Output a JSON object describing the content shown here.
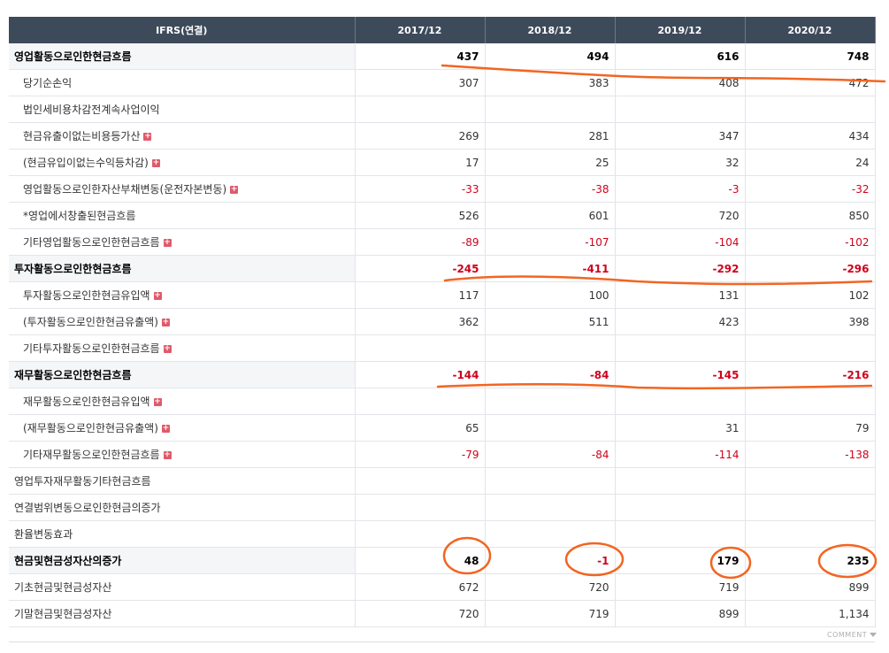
{
  "table": {
    "headers": [
      "IFRS(연결)",
      "2017/12",
      "2018/12",
      "2019/12",
      "2020/12"
    ],
    "rows": [
      {
        "label": "영업활동으로인한현금흐름",
        "level": "main",
        "expand": false,
        "values": [
          "437",
          "494",
          "616",
          "748"
        ],
        "neg": [
          false,
          false,
          false,
          false
        ]
      },
      {
        "label": "당기순손익",
        "level": "sub",
        "expand": false,
        "values": [
          "307",
          "383",
          "408",
          "472"
        ],
        "neg": [
          false,
          false,
          false,
          false
        ]
      },
      {
        "label": "법인세비용차감전계속사업이익",
        "level": "sub",
        "expand": false,
        "values": [
          "",
          "",
          "",
          ""
        ],
        "neg": [
          false,
          false,
          false,
          false
        ]
      },
      {
        "label": "현금유출이없는비용등가산",
        "level": "sub",
        "expand": true,
        "values": [
          "269",
          "281",
          "347",
          "434"
        ],
        "neg": [
          false,
          false,
          false,
          false
        ]
      },
      {
        "label": "(현금유입이없는수익등차감)",
        "level": "sub",
        "expand": true,
        "values": [
          "17",
          "25",
          "32",
          "24"
        ],
        "neg": [
          false,
          false,
          false,
          false
        ]
      },
      {
        "label": "영업활동으로인한자산부채변동(운전자본변동)",
        "level": "sub",
        "expand": true,
        "values": [
          "-33",
          "-38",
          "-3",
          "-32"
        ],
        "neg": [
          true,
          true,
          true,
          true
        ]
      },
      {
        "label": "*영업에서창출된현금흐름",
        "level": "sub",
        "expand": false,
        "values": [
          "526",
          "601",
          "720",
          "850"
        ],
        "neg": [
          false,
          false,
          false,
          false
        ]
      },
      {
        "label": "기타영업활동으로인한현금흐름",
        "level": "sub",
        "expand": true,
        "values": [
          "-89",
          "-107",
          "-104",
          "-102"
        ],
        "neg": [
          true,
          true,
          true,
          true
        ]
      },
      {
        "label": "투자활동으로인한현금흐름",
        "level": "main",
        "expand": false,
        "values": [
          "-245",
          "-411",
          "-292",
          "-296"
        ],
        "neg": [
          true,
          true,
          true,
          true
        ]
      },
      {
        "label": "투자활동으로인한현금유입액",
        "level": "sub",
        "expand": true,
        "values": [
          "117",
          "100",
          "131",
          "102"
        ],
        "neg": [
          false,
          false,
          false,
          false
        ]
      },
      {
        "label": "(투자활동으로인한현금유출액)",
        "level": "sub",
        "expand": true,
        "values": [
          "362",
          "511",
          "423",
          "398"
        ],
        "neg": [
          false,
          false,
          false,
          false
        ]
      },
      {
        "label": "기타투자활동으로인한현금흐름",
        "level": "sub",
        "expand": true,
        "values": [
          "",
          "",
          "",
          ""
        ],
        "neg": [
          false,
          false,
          false,
          false
        ]
      },
      {
        "label": "재무활동으로인한현금흐름",
        "level": "main",
        "expand": false,
        "values": [
          "-144",
          "-84",
          "-145",
          "-216"
        ],
        "neg": [
          true,
          true,
          true,
          true
        ]
      },
      {
        "label": "재무활동으로인한현금유입액",
        "level": "sub",
        "expand": true,
        "values": [
          "",
          "",
          "",
          ""
        ],
        "neg": [
          false,
          false,
          false,
          false
        ]
      },
      {
        "label": "(재무활동으로인한현금유출액)",
        "level": "sub",
        "expand": true,
        "values": [
          "65",
          "",
          "31",
          "79"
        ],
        "neg": [
          false,
          false,
          false,
          false
        ]
      },
      {
        "label": "기타재무활동으로인한현금흐름",
        "level": "sub",
        "expand": true,
        "values": [
          "-79",
          "-84",
          "-114",
          "-138"
        ],
        "neg": [
          true,
          true,
          true,
          true
        ]
      },
      {
        "label": "영업투자재무활동기타현금흐름",
        "level": "plain",
        "expand": false,
        "values": [
          "",
          "",
          "",
          ""
        ],
        "neg": [
          false,
          false,
          false,
          false
        ]
      },
      {
        "label": "연결범위변동으로인한현금의증가",
        "level": "plain",
        "expand": false,
        "values": [
          "",
          "",
          "",
          ""
        ],
        "neg": [
          false,
          false,
          false,
          false
        ]
      },
      {
        "label": "환율변동효과",
        "level": "plain",
        "expand": false,
        "values": [
          "",
          "",
          "",
          ""
        ],
        "neg": [
          false,
          false,
          false,
          false
        ]
      },
      {
        "label": "현금및현금성자산의증가",
        "level": "main",
        "expand": false,
        "values": [
          "48",
          "-1",
          "179",
          "235"
        ],
        "neg": [
          false,
          true,
          false,
          false
        ]
      },
      {
        "label": "기초현금및현금성자산",
        "level": "plain",
        "expand": false,
        "values": [
          "672",
          "720",
          "719",
          "899"
        ],
        "neg": [
          false,
          false,
          false,
          false
        ]
      },
      {
        "label": "기말현금및현금성자산",
        "level": "plain",
        "expand": false,
        "values": [
          "720",
          "719",
          "899",
          "1,134"
        ],
        "neg": [
          false,
          false,
          false,
          false
        ]
      }
    ]
  },
  "footer": {
    "comment_label": "COMMENT"
  },
  "colors": {
    "header_bg": "#3d4a5a",
    "negative": "#d0021b",
    "annotation": "#f26522",
    "expand_icon": "#e05a6a"
  }
}
